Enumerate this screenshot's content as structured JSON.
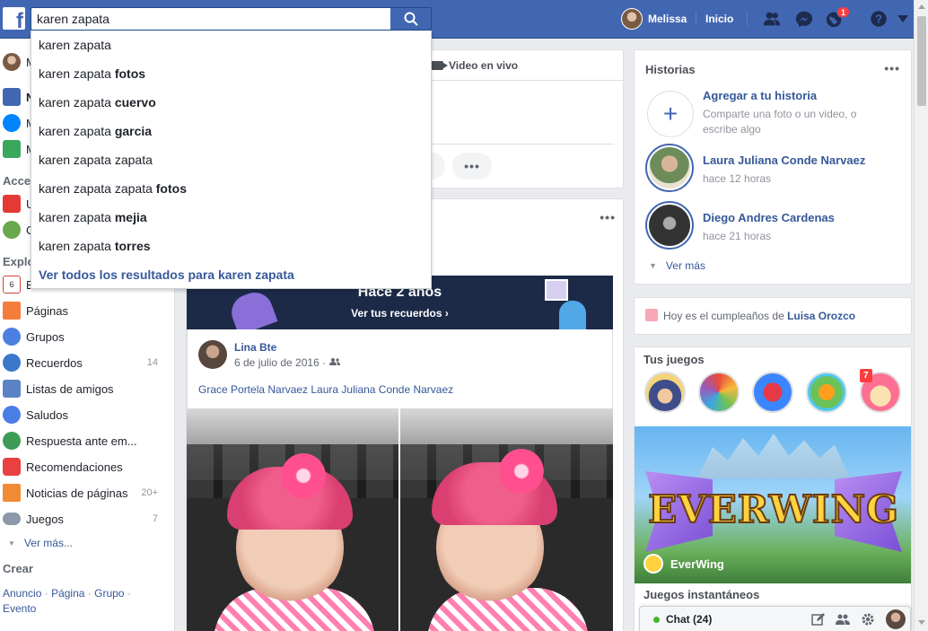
{
  "colors": {
    "brand": "#4267b2",
    "link": "#365899",
    "notification": "#fa3e3e",
    "online": "#42b72a"
  },
  "topbar": {
    "logo_letter": "f",
    "search_value": "karen zapata",
    "profile_name": "Melissa",
    "home_label": "Inicio",
    "notifications_count": "1",
    "icons": [
      "friends-icon",
      "messenger-icon",
      "notifications-globe-icon",
      "help-icon",
      "account-menu-caret-icon"
    ]
  },
  "search_dropdown": {
    "items": [
      {
        "base": "karen zapata",
        "bold": ""
      },
      {
        "base": "karen zapata ",
        "bold": "fotos"
      },
      {
        "base": "karen zapata ",
        "bold": "cuervo"
      },
      {
        "base": "karen zapata ",
        "bold": "garcia"
      },
      {
        "base": "karen zapata zapata",
        "bold": ""
      },
      {
        "base": "karen zapata zapata ",
        "bold": "fotos"
      },
      {
        "base": "karen zapata ",
        "bold": "mejia"
      },
      {
        "base": "karen zapata ",
        "bold": "torres"
      }
    ],
    "see_all": "Ver todos los resultados para karen zapata"
  },
  "left_sidebar": {
    "top_items": [
      {
        "label": "M",
        "icon": "profile-avatar"
      },
      {
        "label": "N",
        "icon": "news-feed-icon"
      },
      {
        "label": "M",
        "icon": "messenger-icon"
      },
      {
        "label": "M",
        "icon": "marketplace-icon"
      }
    ],
    "shortcuts_heading": "Acce",
    "shortcuts": [
      {
        "label": "U",
        "icon": "uno-game-icon"
      },
      {
        "label": "C",
        "icon": "tree-icon"
      }
    ],
    "explore_heading": "Explo",
    "explore": [
      {
        "label": "E",
        "icon": "calendar-icon",
        "count": ""
      },
      {
        "label": "Páginas",
        "icon": "flag-icon",
        "count": ""
      },
      {
        "label": "Grupos",
        "icon": "groups-icon",
        "count": ""
      },
      {
        "label": "Recuerdos",
        "icon": "memories-clock-icon",
        "count": "14"
      },
      {
        "label": "Listas de amigos",
        "icon": "friend-lists-icon",
        "count": ""
      },
      {
        "label": "Saludos",
        "icon": "wave-hand-icon",
        "count": ""
      },
      {
        "label": "Respuesta ante em...",
        "icon": "crisis-response-icon",
        "count": ""
      },
      {
        "label": "Recomendaciones",
        "icon": "recommendations-icon",
        "count": ""
      },
      {
        "label": "Noticias de páginas",
        "icon": "pages-feed-icon",
        "count": "20+"
      },
      {
        "label": "Juegos",
        "icon": "gamepad-icon",
        "count": "7"
      }
    ],
    "see_more": "Ver más...",
    "create_heading": "Crear",
    "create_links": [
      "Anuncio",
      "Página",
      "Grupo",
      "Evento"
    ],
    "create_sep": "·"
  },
  "composer": {
    "live_video": "Video en vivo",
    "more": "•••"
  },
  "memory": {
    "dots": "•••",
    "banner_title": "Hace 2 años",
    "banner_link": "Ver tus recuerdos ›",
    "post_author": "Lina Bte",
    "post_date": "6 de julio de 2016 ·",
    "post_tags": "Grace Portela Narvaez Laura Juliana Conde Narvaez"
  },
  "stories": {
    "title": "Historias",
    "dots": "•••",
    "add_title": "Agregar a tu historia",
    "add_sub": "Comparte una foto o un video, o escribe algo",
    "items": [
      {
        "name": "Laura Juliana Conde Narvaez",
        "time": "hace 12 horas"
      },
      {
        "name": "Diego Andres Cardenas",
        "time": "hace 21 horas"
      }
    ],
    "see_more": "Ver más"
  },
  "birthday": {
    "prefix": "Hoy es el cumpleaños de ",
    "name": "Luisa Orozco"
  },
  "games": {
    "title": "Tus juegos",
    "badge": "7",
    "featured": "EverWing",
    "featured_logo_text": "EVERWING",
    "instant_title": "Juegos instantáneos"
  },
  "chat": {
    "label": "Chat (24)"
  }
}
